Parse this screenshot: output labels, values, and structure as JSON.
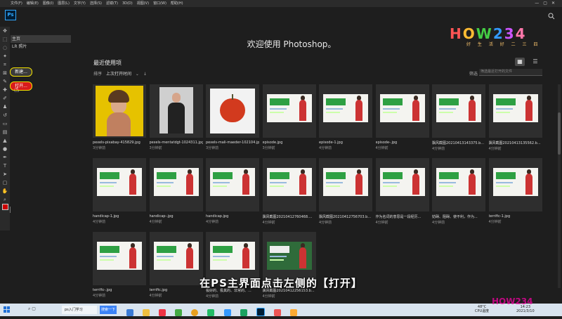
{
  "menubar": {
    "items": [
      "文件(F)",
      "编辑(E)",
      "图像(I)",
      "图层(L)",
      "文字(Y)",
      "选择(S)",
      "滤镜(T)",
      "3D(D)",
      "视图(V)",
      "窗口(W)",
      "帮助(H)"
    ]
  },
  "app": {
    "logo": "Ps",
    "welcome": "欢迎使用 Photoshop。"
  },
  "sidebar": {
    "items": [
      "主页",
      "LR 照片"
    ],
    "new_button": "新建...",
    "open_button": "打开..."
  },
  "recent": {
    "title": "最近使用项",
    "sort_label": "排序",
    "sort_value": "上次打开时间",
    "filter_label": "筛选",
    "filter_placeholder": "筛选最近打开的文件",
    "files": [
      {
        "name": "pexels-pixabay-415829.jpg",
        "time": "3分钟前",
        "kind": "portrait-yellow"
      },
      {
        "name": "pexels-mentatdgt-1024311.jpg",
        "time": "3分钟前",
        "kind": "portrait-gray"
      },
      {
        "name": "pexels-mali-maeder-102104.jpg",
        "time": "3分钟前",
        "kind": "apple"
      },
      {
        "name": "episode.jpg",
        "time": "3分钟前",
        "kind": "slide",
        "word": "episode"
      },
      {
        "name": "episode-1.jpg",
        "time": "4分钟前",
        "kind": "slide",
        "word": "episode"
      },
      {
        "name": "episode-.jpg",
        "time": "4分钟前",
        "kind": "slide",
        "word": "episode"
      },
      {
        "name": "飘风截图20210413143375.b...",
        "time": "4分钟前",
        "kind": "slide",
        "word": ""
      },
      {
        "name": "飘风截图20210413135562.b...",
        "time": "4分钟前",
        "kind": "slide",
        "word": "episode"
      },
      {
        "name": "handicap-1.jpg",
        "time": "4分钟前",
        "kind": "slide",
        "word": "handicap"
      },
      {
        "name": "handicap-.jpg",
        "time": "4分钟前",
        "kind": "slide",
        "word": "handicap"
      },
      {
        "name": "handicap.jpg",
        "time": "4分钟前",
        "kind": "slide",
        "word": "handicap"
      },
      {
        "name": "飘风截图20210412760468....",
        "time": "4分钟前",
        "kind": "slide",
        "word": ""
      },
      {
        "name": "飘风截图20210412756703.b...",
        "time": "4分钟前",
        "kind": "slide",
        "word": ""
      },
      {
        "name": "作为名词的意思是一段经历...",
        "time": "4分钟前",
        "kind": "slide",
        "word": "episode"
      },
      {
        "name": "妨碍、阻碍、使不利，作为...",
        "time": "4分钟前",
        "kind": "slide",
        "word": "handicap"
      },
      {
        "name": "terrific-1.jpg",
        "time": "4分钟前",
        "kind": "slide",
        "word": "terrific"
      },
      {
        "name": "terrific-.jpg",
        "time": "4分钟前",
        "kind": "slide",
        "word": "terrific"
      },
      {
        "name": "terrific.jpg",
        "time": "4分钟前",
        "kind": "slide",
        "word": "terrific"
      },
      {
        "name": "极好的、极其的、非常的、...",
        "time": "4分钟前",
        "kind": "slide",
        "word": "terrific"
      },
      {
        "name": "飘风截图20210412256153.b...",
        "time": "4分钟前",
        "kind": "slide-green",
        "word": ""
      }
    ]
  },
  "caption": "在PS主界面点击左侧的【打开】",
  "watermark": {
    "text": "HOW234",
    "sub": "好 生 活 好 二 三 四"
  },
  "taskbar": {
    "app_label": "ps入门学习",
    "button_label": "搜索一下",
    "temp": "48°C",
    "temp_sub": "CPU温度",
    "time": "14:23",
    "date": "2021/3/10"
  },
  "colors": {
    "accent": "#31a8ff",
    "highlight": "#f5e300",
    "open_red": "#d81b1b"
  }
}
